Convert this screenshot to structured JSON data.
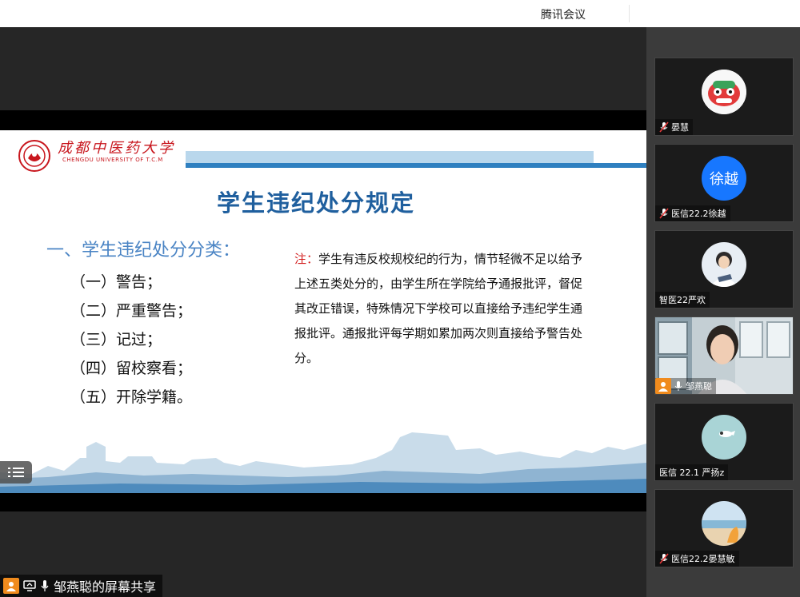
{
  "window": {
    "title": "腾讯会议"
  },
  "slide": {
    "logo_cn": "成都中医药大学",
    "logo_en": "CHENGDU UNIVERSITY OF T.C.M",
    "title": "学生违纪处分规定",
    "section": "一、学生违纪处分分类：",
    "items": [
      "（一）警告；",
      "（二）严重警告；",
      "（三）记过；",
      "（四）留校察看；",
      "（五）开除学籍。"
    ],
    "note_label": "注：",
    "note_text": "学生有违反校规校纪的行为，情节轻微不足以给予上述五类处分的，由学生所在学院给予通报批评，督促其改正错误，特殊情况下学校可以直接给予违纪学生通报批评。通报批评每学期如累加两次则直接给予警告处分。"
  },
  "participants": [
    {
      "name": "晏慧",
      "muted": true,
      "avatar": "lion-dance-icon"
    },
    {
      "name": "医信22.2徐越",
      "muted": true,
      "avatar_text": "徐越"
    },
    {
      "name": "智医22严欢",
      "muted": false,
      "avatar": "photo-icon"
    },
    {
      "name": "邹燕聪",
      "muted": false,
      "avatar": "video-feed",
      "sharing": true
    },
    {
      "name": "医信 22.1 严扬z",
      "muted": false,
      "avatar": "bird-icon"
    },
    {
      "name": "医信22.2晏慧敏",
      "muted": true,
      "avatar": "beach-photo-icon"
    }
  ],
  "share_label": "邹燕聪的屏幕共享",
  "colors": {
    "accent_blue": "#1777ff",
    "title_blue": "#1f5f9e",
    "note_red": "#d21d1d",
    "school_red": "#c8161d",
    "presenter_orange": "#f08b1d"
  }
}
